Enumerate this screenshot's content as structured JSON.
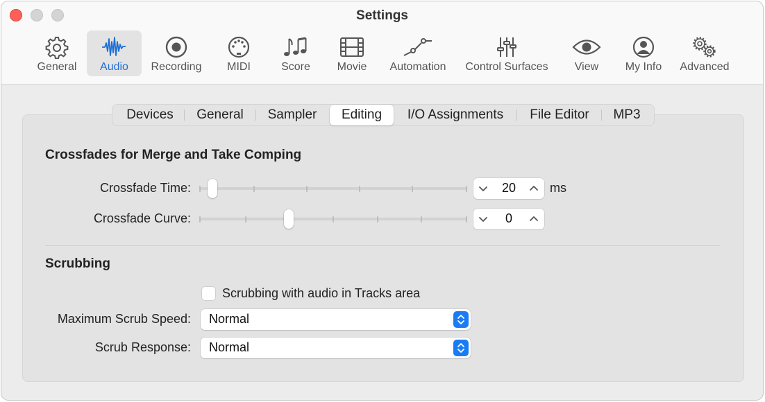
{
  "window": {
    "title": "Settings"
  },
  "toolbar": {
    "items": [
      {
        "label": "General",
        "icon": "gear-icon",
        "selected": false
      },
      {
        "label": "Audio",
        "icon": "waveform-icon",
        "selected": true
      },
      {
        "label": "Recording",
        "icon": "record-icon",
        "selected": false
      },
      {
        "label": "MIDI",
        "icon": "midi-connector-icon",
        "selected": false
      },
      {
        "label": "Score",
        "icon": "music-notes-icon",
        "selected": false
      },
      {
        "label": "Movie",
        "icon": "film-icon",
        "selected": false
      },
      {
        "label": "Automation",
        "icon": "automation-curve-icon",
        "selected": false
      },
      {
        "label": "Control Surfaces",
        "icon": "faders-icon",
        "selected": false
      },
      {
        "label": "View",
        "icon": "eye-icon",
        "selected": false
      },
      {
        "label": "My Info",
        "icon": "person-icon",
        "selected": false
      },
      {
        "label": "Advanced",
        "icon": "gears-icon",
        "selected": false
      }
    ],
    "accent_color": "#1f6fd6"
  },
  "tabs": [
    {
      "label": "Devices",
      "selected": false
    },
    {
      "label": "General",
      "selected": false
    },
    {
      "label": "Sampler",
      "selected": false
    },
    {
      "label": "Editing",
      "selected": true
    },
    {
      "label": "I/O Assignments",
      "selected": false
    },
    {
      "label": "File Editor",
      "selected": false
    },
    {
      "label": "MP3",
      "selected": false
    }
  ],
  "crossfades": {
    "heading": "Crossfades for Merge and Take Comping",
    "time": {
      "label": "Crossfade Time:",
      "value": "20",
      "unit": "ms",
      "slider_fraction": 0.05
    },
    "curve": {
      "label": "Crossfade Curve:",
      "value": "0",
      "slider_fraction": 0.335
    }
  },
  "scrubbing": {
    "heading": "Scrubbing",
    "checkbox_label": "Scrubbing with audio in Tracks area",
    "checkbox_checked": false,
    "max_speed": {
      "label": "Maximum Scrub Speed:",
      "value": "Normal"
    },
    "response": {
      "label": "Scrub Response:",
      "value": "Normal"
    }
  }
}
